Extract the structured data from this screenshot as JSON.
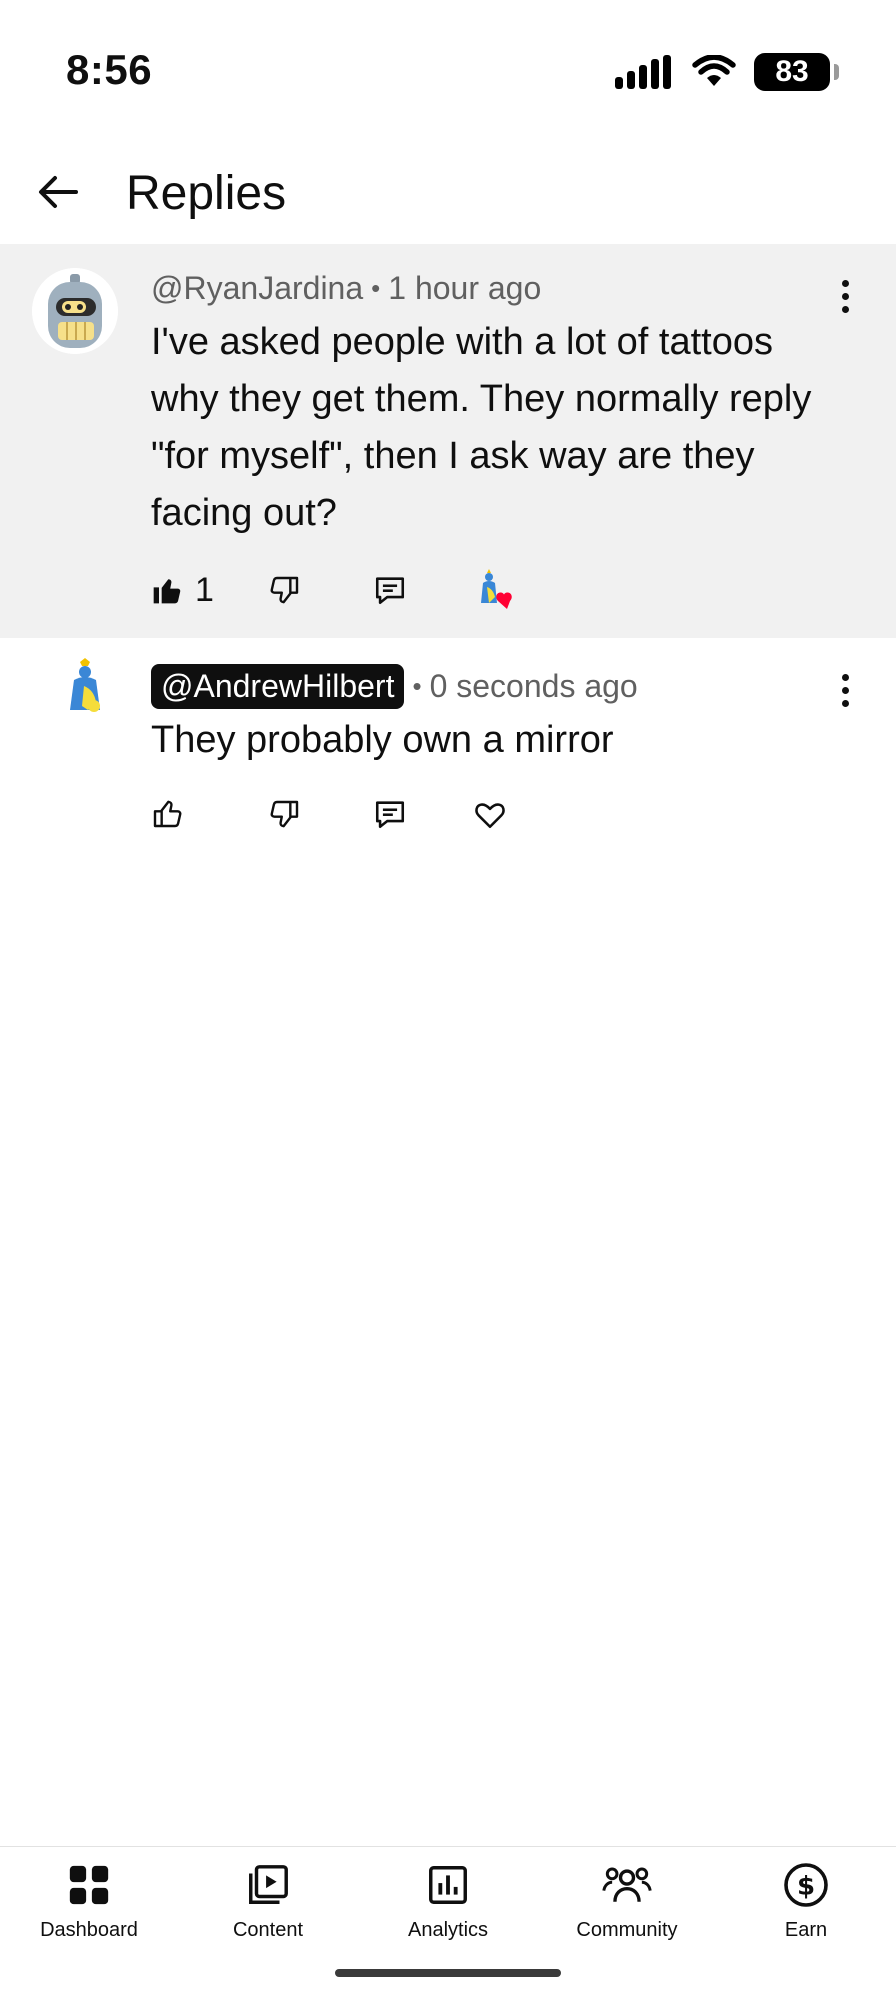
{
  "status_bar": {
    "time": "8:56",
    "battery": "83"
  },
  "header": {
    "title": "Replies"
  },
  "comments": [
    {
      "handle": "@RyanJardina",
      "separator": "•",
      "time": "1 hour ago",
      "text": "I've asked people with a lot of tattoos why they get them. They normally reply \"for myself\", then I ask way are they facing out?",
      "like_count": "1",
      "liked": true,
      "hearted_by_creator": true
    },
    {
      "handle": "@AndrewHilbert",
      "separator": "•",
      "time": "0 seconds ago",
      "text": "They probably own a mirror",
      "liked": false,
      "hearted_by_creator": false
    }
  ],
  "bottom_nav": [
    {
      "label": "Dashboard",
      "icon": "dashboard-icon"
    },
    {
      "label": "Content",
      "icon": "content-icon"
    },
    {
      "label": "Analytics",
      "icon": "analytics-icon"
    },
    {
      "label": "Community",
      "icon": "community-icon"
    },
    {
      "label": "Earn",
      "icon": "earn-icon"
    }
  ],
  "colors": {
    "highlight_bg": "#f1f1f1",
    "heart": "#ff0033",
    "text": "#0f0f0f",
    "meta": "#606060"
  }
}
